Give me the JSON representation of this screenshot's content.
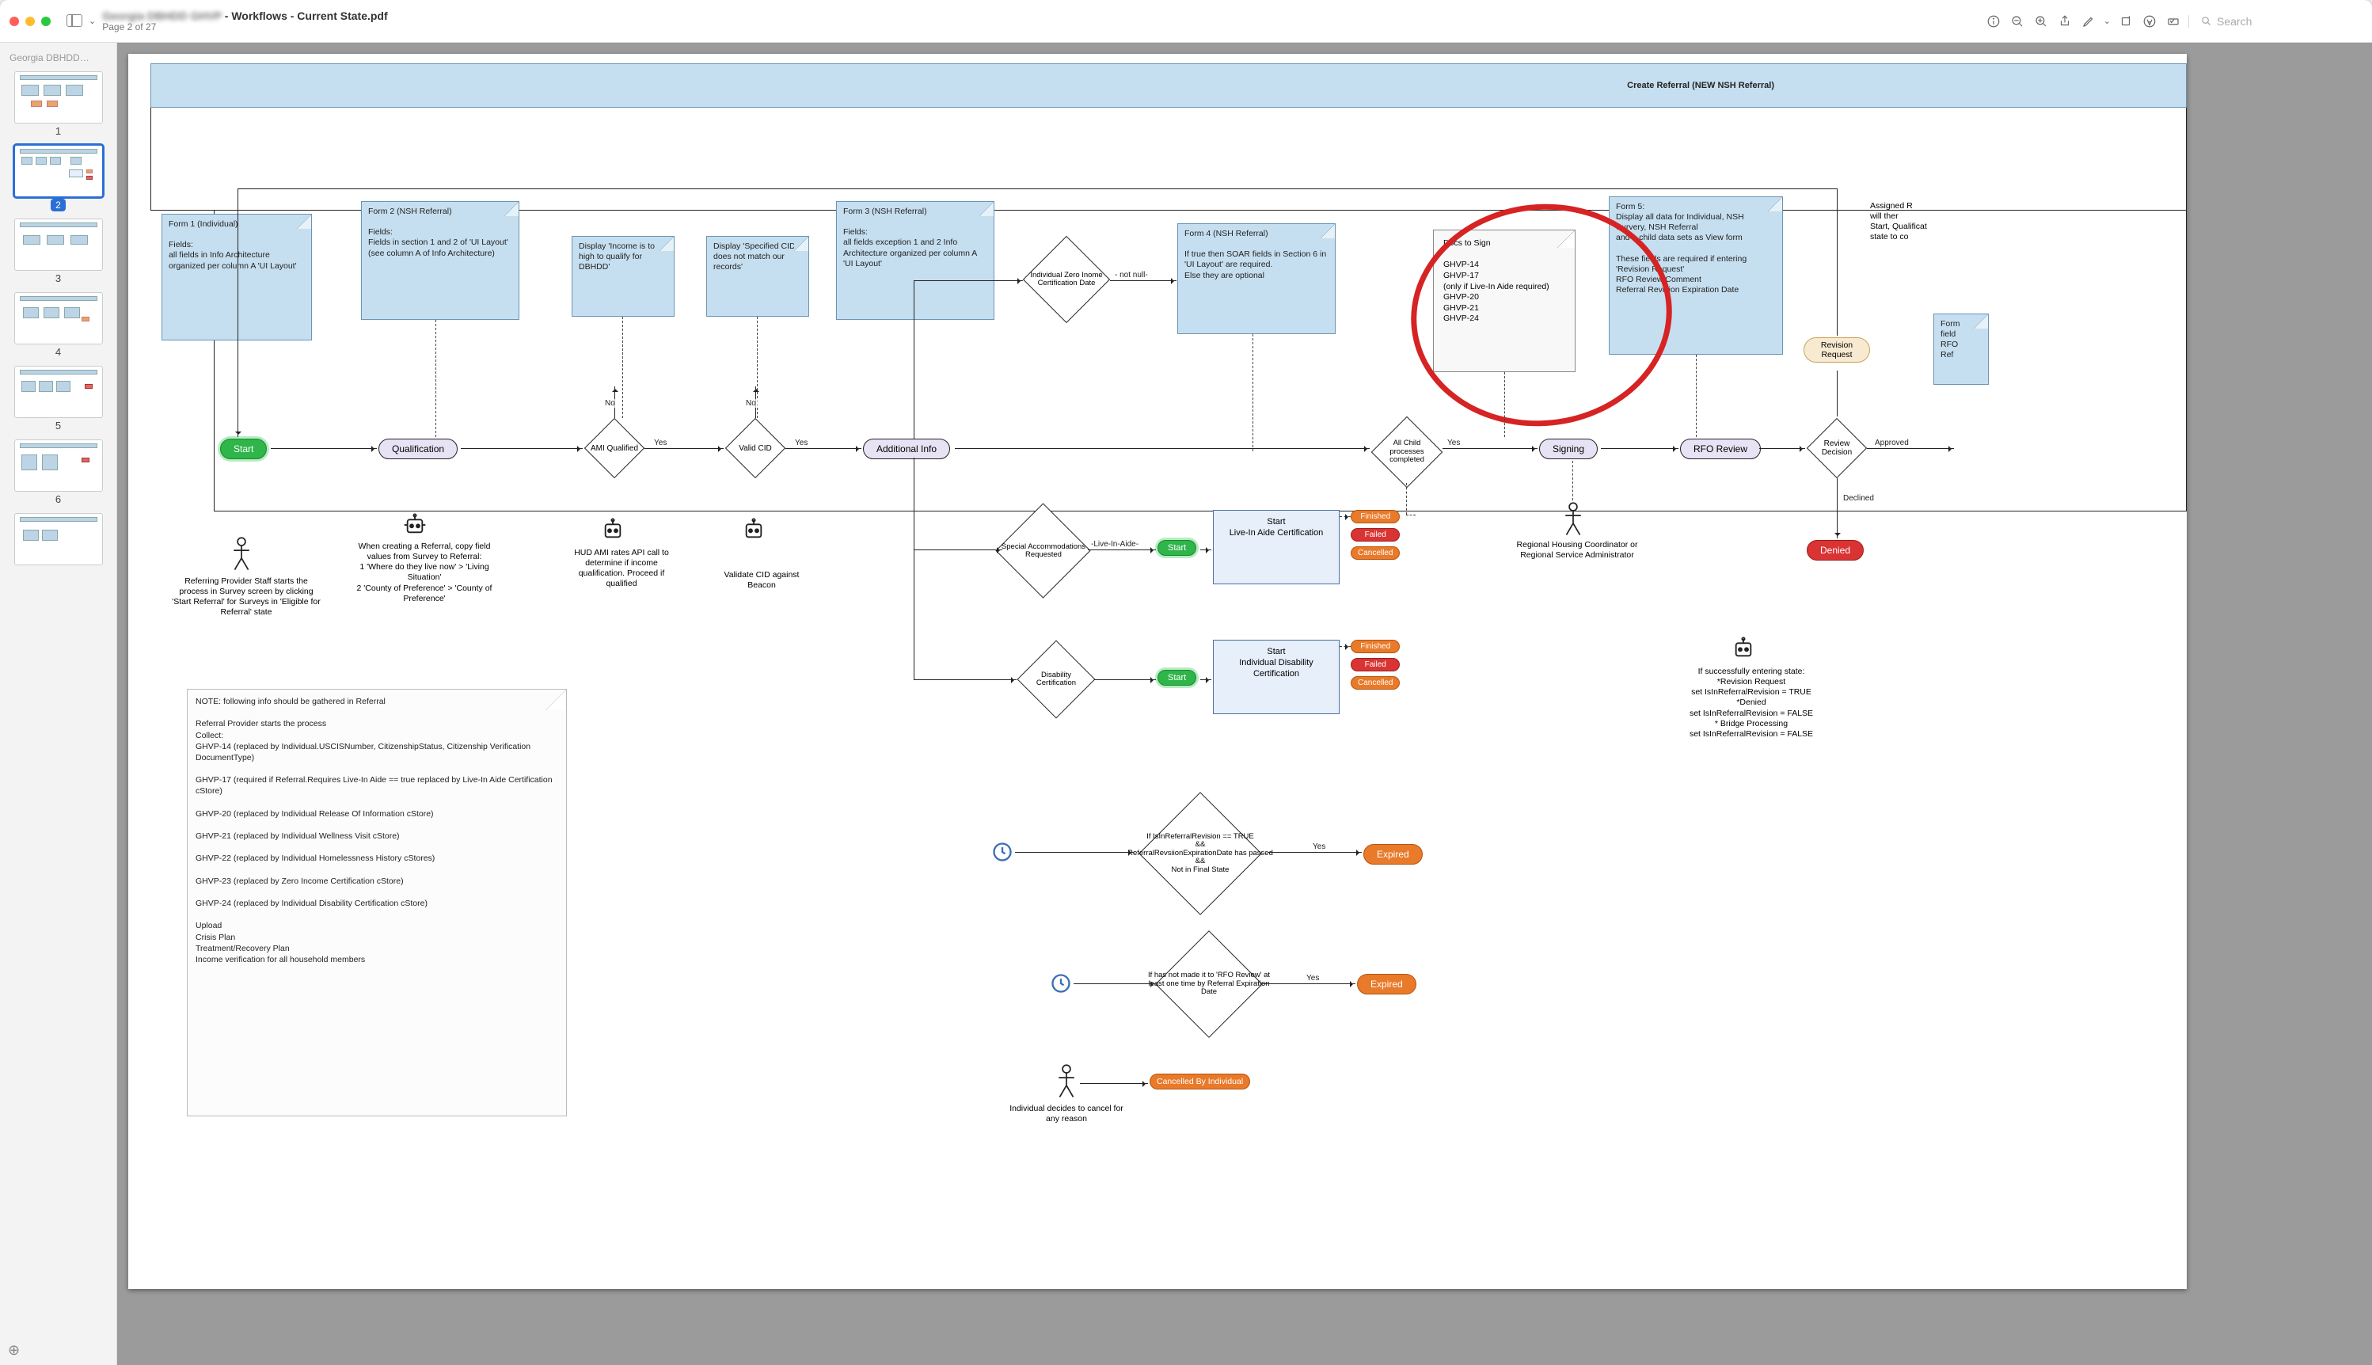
{
  "app": {
    "title_blur": "Georgia DBHDD GHVP",
    "title_rest": " - Workflows - Current State.pdf",
    "page_indicator": "Page 2 of 27",
    "search_placeholder": "Search"
  },
  "sidebar": {
    "heading": "Georgia DBHDD…",
    "thumbs": [
      "1",
      "2",
      "3",
      "4",
      "5",
      "6"
    ],
    "selected": 2
  },
  "banner": "Create Referral (NEW NSH Referral)",
  "notes": {
    "form1": "Form 1 (Individual)\n\nFields:\nall fields in Info Architecture  organized per column A 'UI Layout'",
    "form2": "Form 2 (NSH Referral)\n\nFields:\nFields in section 1 and 2 of 'UI Layout' (see column A of Info Architecture)",
    "disp_income": "Display 'Income is to high to qualify for DBHDD'",
    "disp_cid": "Display 'Specified CID does not match our records'",
    "form3": "Form 3 (NSH Referral)\n\nFields:\nall fields exception 1 and 2 Info Architecture organized per column A 'UI Layout'",
    "form4": "Form 4 (NSH Referral)\n\nIf true then SOAR fields in Section 6 in 'UI Layout' are required.\nElse they are optional",
    "form5": "Form 5:\nDisplay all data for Individual, NSH Survery, NSH Referral\nand a child data sets as View form\n\nThese fields are required if entering 'Revision Request'\nRFO Review Comment\nReferral Revision Expiration Date",
    "docs": "Docs to Sign\n\nGHVP-14\nGHVP-17\n(only if Live-In Aide required)\nGHVP-20\nGHVP-21\nGHVP-24",
    "rightcut1": "Assigned R\nwill ther\nStart, Qualificat\nstate to co",
    "rightcut2": "Form\nfield\nRFO\nRef",
    "bignote": "NOTE: following info should be gathered in Referral\n\nReferral Provider starts the process\nCollect:\nGHVP-14 (replaced by Individual.USCISNumber, CitizenshipStatus, Citizenship Verification DocumentType)\n\nGHVP-17 (required if Referral.Requires Live-In Aide == true replaced by Live-In Aide Certification cStore)\n\nGHVP-20 (replaced by Individual Release Of Information cStore)\n\nGHVP-21 (replaced by Individual Wellness Visit cStore)\n\nGHVP-22 (replaced by Individual Homelessness History cStores)\n\nGHVP-23 (replaced by Zero Income Certification cStore)\n\nGHVP-24 (replaced by Individual Disability Certification cStore)\n\nUpload\nCrisis Plan\nTreatment/Recovery Plan\nIncome verification for all household members"
  },
  "process": {
    "start": "Start",
    "qualification": "Qualification",
    "ami": "AMI Qualified",
    "validcid": "Valid CID",
    "addlinfo": "Additional Info",
    "zeroincome": "Individual Zero Inome Certification Date",
    "child_complete": "All Child processes completed",
    "signing": "Signing",
    "rfo": "RFO Review",
    "reviewdec": "Review Decision",
    "revreq": "Revision Request",
    "spec_accom": "Special Accommodations Requested",
    "disab_cert": "Disability Certification",
    "sub_liveaide": "Start\nLive-In Aide Certification",
    "sub_disab": "Start\nIndividual Disability Certification",
    "start2": "Start",
    "start3": "Start",
    "finished": "Finished",
    "failed": "Failed",
    "cancelled": "Cancelled",
    "denied": "Denied",
    "expired": "Expired",
    "cancelled_by_ind": "Cancelled By Individual",
    "approved": "Approved",
    "declined": "Declined",
    "yes": "Yes",
    "no": "No",
    "notnull": "- not null-",
    "liveinaide": "-Live-In-Aide-"
  },
  "captions": {
    "referring": "Referring Provider Staff starts the process in Survey screen by clicking 'Start Referral' for Surveys in 'Eligible for Referral' state",
    "copyvals": "When creating a Referral, copy field values from Survey to Referral:\n1 'Where do they live now' > 'Living Situation'\n2 'County of Preference' > 'County of Preference'",
    "hud": "HUD AMI rates API call to determine if income qualification. Proceed if qualified",
    "validate": "Validate CID against Beacon",
    "rhcrsa": "Regional Housing Coordinator or Regional Service Administrator",
    "setflags": "If successfully entering state:\n*Revision Request\nset IsInReferralRevision = TRUE\n*Denied\nset IsInReferralRevision = FALSE\n* Bridge Processing\nset IsInReferralRevision = FALSE",
    "exp1": "If IsInReferralRevision == TRUE\n&&\nReferralRevsiionExpirationDate has passed\n&&\nNot in Final State",
    "exp2": "If has not made it to 'RFO Review' at least one time by Referral Expiration Date",
    "ind_cancel": "Individual decides to cancel for any reason"
  }
}
